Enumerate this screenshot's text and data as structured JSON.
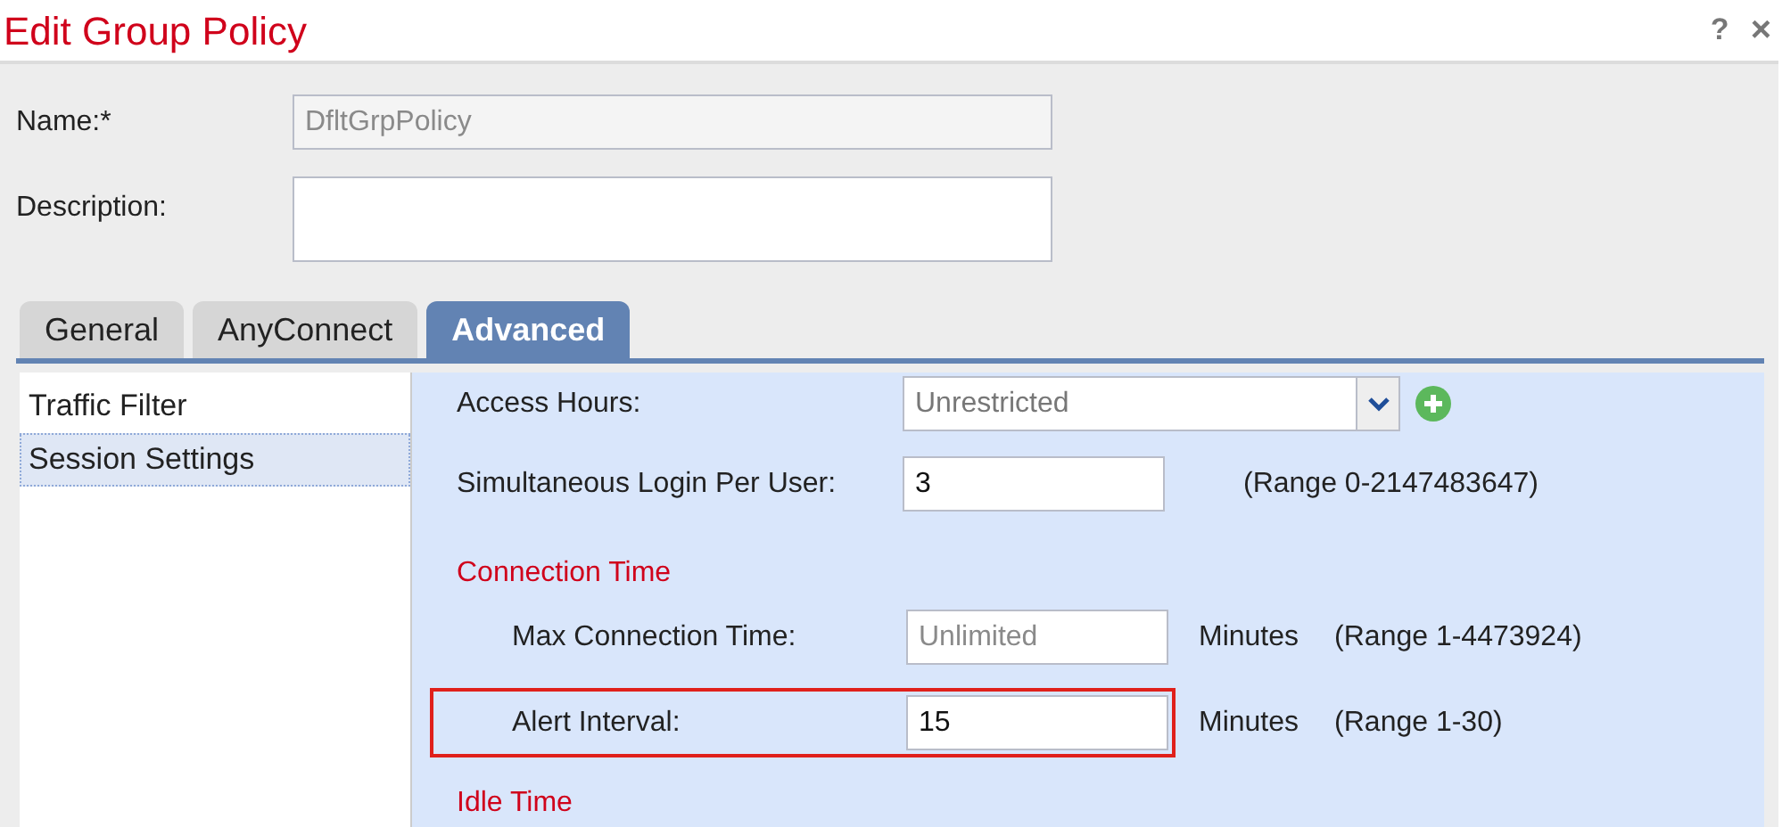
{
  "window": {
    "title": "Edit Group Policy",
    "help": "?",
    "close": "×"
  },
  "name_field": {
    "label": "Name:*",
    "value": "DfltGrpPolicy",
    "disabled": true
  },
  "description_field": {
    "label": "Description:"
  },
  "tabs": [
    {
      "label": "General",
      "selected": false
    },
    {
      "label": "AnyConnect",
      "selected": false
    },
    {
      "label": "Advanced",
      "selected": true
    }
  ],
  "sidebar": {
    "items": [
      {
        "label": "Traffic Filter",
        "selected": false
      },
      {
        "label": "Session Settings",
        "selected": true
      }
    ]
  },
  "settings": {
    "access_hours": {
      "label": "Access Hours:",
      "value": "Unrestricted"
    },
    "simultaneous_login": {
      "label": "Simultaneous Login Per User:",
      "value": "3",
      "range": "(Range 0-2147483647)"
    },
    "connection_time": {
      "heading": "Connection Time",
      "rows": [
        {
          "label": "Max Connection Time:",
          "placeholder": "Unlimited",
          "unit": "Minutes",
          "range": "(Range 1-4473924)",
          "highlighted": false
        },
        {
          "label": "Alert Interval:",
          "value": "15",
          "unit": "Minutes",
          "range": "(Range 1-30)",
          "highlighted": true
        }
      ]
    },
    "idle_time": {
      "heading": "Idle Time"
    }
  }
}
